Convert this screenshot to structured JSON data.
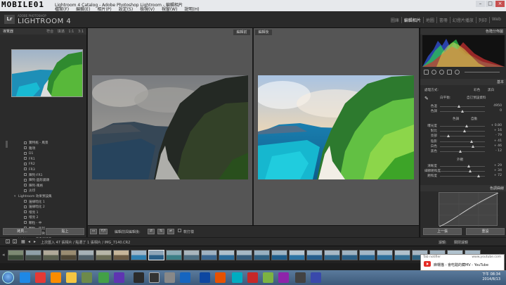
{
  "window": {
    "title": "Lightroom 4 Catalog - Adobe Photoshop Lightroom - 編輯相片",
    "watermark": "MOBILE01",
    "menu": [
      "檔案(F)",
      "編輯(E)",
      "相片(P)",
      "設定(S)",
      "檢視(V)",
      "視窗(W)",
      "說明(H)"
    ],
    "controls": [
      "–",
      "□",
      "×"
    ]
  },
  "brand": {
    "logo": "Lr",
    "sub": "ADOBE PHOTOSHOP",
    "name": "LIGHTROOM 4"
  },
  "modules": [
    {
      "label": "圖庫",
      "active": false
    },
    {
      "label": "編輯相片",
      "active": true
    },
    {
      "label": "地圖",
      "active": false
    },
    {
      "label": "書冊",
      "active": false
    },
    {
      "label": "幻燈片播放",
      "active": false
    },
    {
      "label": "列印",
      "active": false
    },
    {
      "label": "Web",
      "active": false
    }
  ],
  "left_panel": {
    "navigator_title": "導覽器",
    "navigator_options": [
      "符合",
      "填滿",
      "1:1",
      "3:1"
    ],
    "collections": [
      {
        "tri": "",
        "label": "寶特瓶 - 風景",
        "box": true
      },
      {
        "tri": "",
        "label": "雜項",
        "box": true
      },
      {
        "tri": "",
        "label": "D1",
        "box": true
      },
      {
        "tri": "",
        "label": "FR1",
        "box": true
      },
      {
        "tri": "",
        "label": "FR2",
        "box": true
      },
      {
        "tri": "",
        "label": "FR3",
        "box": true
      },
      {
        "tri": "",
        "label": "陣列-FR1",
        "box": true
      },
      {
        "tri": "",
        "label": "陣列-圓形鏡頭",
        "box": true
      },
      {
        "tri": "",
        "label": "陣列-風格",
        "box": true
      },
      {
        "tri": "",
        "label": "淡印",
        "box": true
      },
      {
        "tri": "▾",
        "label": "Lightroom 效果預設集",
        "box": false
      },
      {
        "tri": "",
        "label": "邊緣暗化 1",
        "box": true
      },
      {
        "tri": "",
        "label": "邊緣暗化 2",
        "box": true
      },
      {
        "tri": "",
        "label": "增亮 1",
        "box": true
      },
      {
        "tri": "",
        "label": "增亮 2",
        "box": true
      },
      {
        "tri": "",
        "label": "顆粒 - 中",
        "box": true
      },
      {
        "tri": "",
        "label": "顆粒 - 強烈",
        "box": true
      },
      {
        "tri": "",
        "label": "顆粒 - 輕微",
        "box": true
      },
      {
        "tri": "▸",
        "label": "Lightroom 黑白預設集",
        "box": false
      },
      {
        "tri": "▸",
        "label": "Lightroom 顏色預設集",
        "box": false
      },
      {
        "tri": "▸",
        "label": "Lightroom 通用預設集",
        "box": false
      }
    ],
    "buttons": [
      "拷貝...",
      "貼上"
    ]
  },
  "center": {
    "before_label": "編輯前",
    "after_label": "編輯後"
  },
  "compare_toolbar": {
    "view_btn": "Y|Y",
    "mode_label": "編輯前與編輯後:",
    "swap_label": "軟打樣"
  },
  "right_panel": {
    "histogram_title": "色階分佈圖",
    "basic_title": "基本",
    "treatment_label": "處理方式:",
    "treatment_options": [
      "彩色",
      "黑白"
    ],
    "wb_label": "白平衡:",
    "wb_value": "自訂預設資料",
    "temp": {
      "label": "色溫",
      "value": "4950",
      "pos": 0.42
    },
    "tint": {
      "label": "色調",
      "value": "0",
      "pos": 0.5
    },
    "tone_label": "色調",
    "tone_auto": "自動",
    "tone_rows": [
      {
        "label": "曝光度",
        "value": "+ 0.80",
        "pos": 0.6
      },
      {
        "label": "對比",
        "value": "+ 16",
        "pos": 0.55
      },
      {
        "label": "亮部",
        "value": "- 79",
        "pos": 0.18
      },
      {
        "label": "陰影",
        "value": "+ 41",
        "pos": 0.7
      },
      {
        "label": "白色",
        "value": "+ 46",
        "pos": 0.73
      },
      {
        "label": "黑色",
        "value": "- 12",
        "pos": 0.45
      }
    ],
    "presence_label": "外觀",
    "presence_rows": [
      {
        "label": "清晰度",
        "value": "+ 29",
        "pos": 0.64
      },
      {
        "label": "細節飽和度",
        "value": "+ 34",
        "pos": 0.67
      },
      {
        "label": "飽和度",
        "value": "+ 72",
        "pos": 0.86
      }
    ],
    "curve_title": "色調曲線",
    "buttons": [
      "上一張",
      "重設"
    ]
  },
  "filmstrip": {
    "nav": [
      "1",
      "2"
    ],
    "info": "上次匯入  47 張相片 / 點選了 1 張相片 / IMG_7140.CR2",
    "filter_label": "濾鏡:",
    "filter_value": "關閉濾鏡"
  },
  "taskbar": {
    "time": "下午 08:34",
    "date": "2014/8/13"
  },
  "notification": {
    "from": "Tab notifier",
    "url": "www.youtube.com",
    "message": "麻糬猫 - 會吃醋的藏MV - YouTube"
  }
}
